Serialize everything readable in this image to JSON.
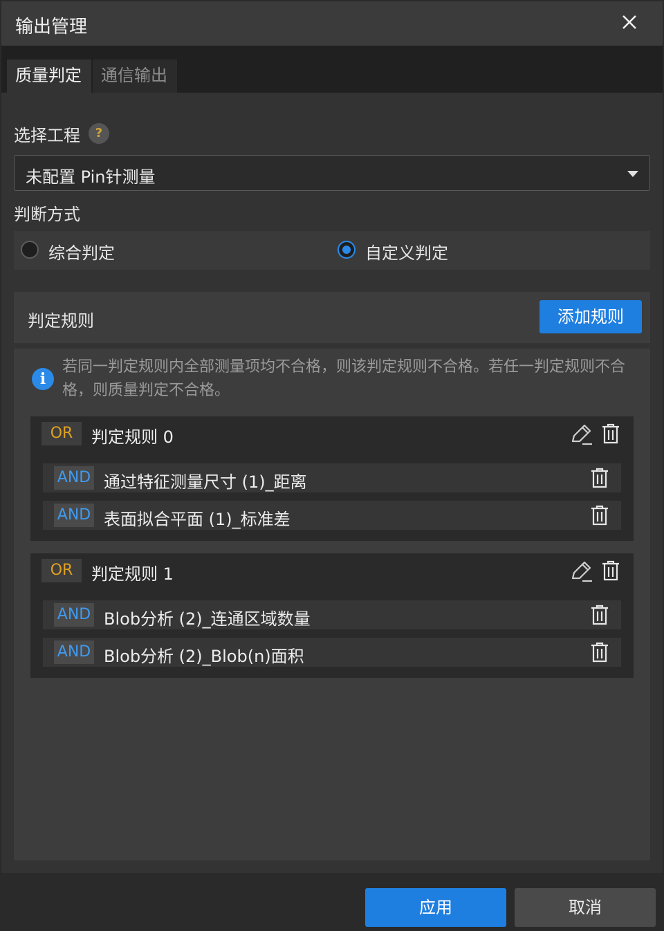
{
  "dialog": {
    "title": "输出管理"
  },
  "tabs": [
    {
      "label": "质量判定",
      "active": true
    },
    {
      "label": "通信输出",
      "active": false
    }
  ],
  "project": {
    "label": "选择工程",
    "help_icon": "?",
    "selected": "未配置 Pin针测量"
  },
  "judge_mode": {
    "label": "判断方式",
    "options": [
      {
        "label": "综合判定",
        "checked": false
      },
      {
        "label": "自定义判定",
        "checked": true
      }
    ]
  },
  "rules": {
    "header": "判定规则",
    "add_button": "添加规则",
    "info_icon": "i",
    "info_text": "若同一判定规则内全部测量项均不合格，则该判定规则不合格。若任一判定规则不合格，则质量判定不合格。",
    "items": [
      {
        "op": "OR",
        "name": "判定规则 0",
        "conditions": [
          {
            "op": "AND",
            "text": "通过特征测量尺寸 (1)_距离"
          },
          {
            "op": "AND",
            "text": "表面拟合平面 (1)_标准差"
          }
        ]
      },
      {
        "op": "OR",
        "name": "判定规则 1",
        "conditions": [
          {
            "op": "AND",
            "text": "Blob分析 (2)_连通区域数量"
          },
          {
            "op": "AND",
            "text": "Blob分析 (2)_Blob(n)面积"
          }
        ]
      }
    ]
  },
  "footer": {
    "apply": "应用",
    "cancel": "取消"
  },
  "colors": {
    "accent": "#1f7fe0",
    "or_badge": "#e0a020",
    "and_badge": "#3f9af0"
  }
}
